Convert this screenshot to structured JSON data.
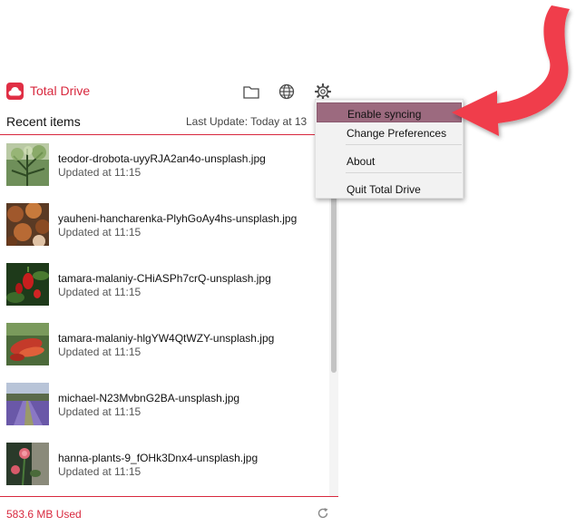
{
  "app": {
    "title": "Total Drive",
    "brand_color": "#d8283e"
  },
  "header": {
    "icons": [
      "folder-icon",
      "globe-icon",
      "gear-icon"
    ]
  },
  "recent": {
    "title": "Recent items",
    "last_update": "Last Update: Today at 13"
  },
  "items": [
    {
      "name": "teodor-drobota-uyyRJA2an4o-unsplash.jpg",
      "time": "Updated at 11:15"
    },
    {
      "name": "yauheni-hancharenka-PlyhGoAy4hs-unsplash.jpg",
      "time": "Updated at 11:15"
    },
    {
      "name": "tamara-malaniy-CHiASPh7crQ-unsplash.jpg",
      "time": "Updated at 11:15"
    },
    {
      "name": "tamara-malaniy-hlgYW4QtWZY-unsplash.jpg",
      "time": "Updated at 11:15"
    },
    {
      "name": "michael-N23MvbnG2BA-unsplash.jpg",
      "time": "Updated at 11:15"
    },
    {
      "name": "hanna-plants-9_fOHk3Dnx4-unsplash.jpg",
      "time": "Updated at 11:15"
    }
  ],
  "footer": {
    "storage": "583.6 MB Used"
  },
  "menu": {
    "items": [
      "Enable syncing",
      "Change Preferences",
      "About",
      "Quit Total Drive"
    ],
    "highlight_color": "#9c6a7f"
  },
  "annotation": {
    "arrow_color": "#f03c4b"
  }
}
